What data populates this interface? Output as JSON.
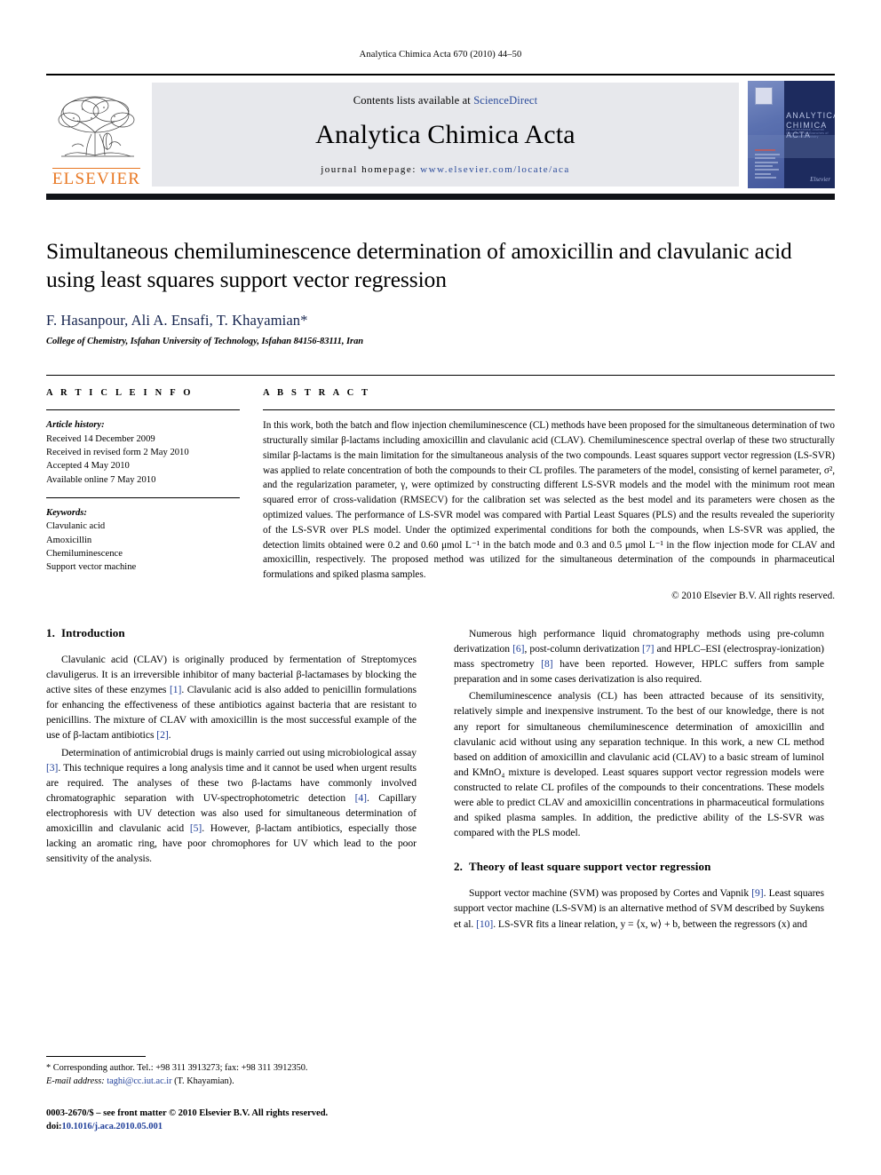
{
  "running_head": "Analytica Chimica Acta 670 (2010) 44–50",
  "masthead": {
    "publisher_name": "ELSEVIER",
    "contents_prefix": "Contents lists available at ",
    "contents_link": "ScienceDirect",
    "journal_title": "Analytica Chimica Acta",
    "homepage_prefix": "journal homepage: ",
    "homepage_url": "www.elsevier.com/locate/aca",
    "cover": {
      "title_line1": "ANALYTICA",
      "title_line2": "CHIMICA ACTA",
      "subtitle": "An International Journal Devoted to All Branches of Analytical Chemistry",
      "brand": "Elsevier"
    }
  },
  "article": {
    "title": "Simultaneous chemiluminescence determination of amoxicillin and clavulanic acid using least squares support vector regression",
    "authors": "F. Hasanpour, Ali A. Ensafi, T. Khayamian",
    "corresponding_marker": "*",
    "affiliation": "College of Chemistry, Isfahan University of Technology, Isfahan 84156-83111, Iran"
  },
  "article_info": {
    "label": "A R T I C L E    I N F O",
    "history_label": "Article history:",
    "history": [
      "Received 14 December 2009",
      "Received in revised form 2 May 2010",
      "Accepted 4 May 2010",
      "Available online 7 May 2010"
    ],
    "keywords_label": "Keywords:",
    "keywords": [
      "Clavulanic acid",
      "Amoxicillin",
      "Chemiluminescence",
      "Support vector machine"
    ]
  },
  "abstract": {
    "label": "A B S T R A C T",
    "text": "In this work, both the batch and flow injection chemiluminescence (CL) methods have been proposed for the simultaneous determination of two structurally similar β-lactams including amoxicillin and clavulanic acid (CLAV). Chemiluminescence spectral overlap of these two structurally similar β-lactams is the main limitation for the simultaneous analysis of the two compounds. Least squares support vector regression (LS-SVR) was applied to relate concentration of both the compounds to their CL profiles. The parameters of the model, consisting of kernel parameter, σ², and the regularization parameter, γ, were optimized by constructing different LS-SVR models and the model with the minimum root mean squared error of cross-validation (RMSECV) for the calibration set was selected as the best model and its parameters were chosen as the optimized values. The performance of LS-SVR model was compared with Partial Least Squares (PLS) and the results revealed the superiority of the LS-SVR over PLS model. Under the optimized experimental conditions for both the compounds, when LS-SVR was applied, the detection limits obtained were 0.2 and 0.60 μmol L⁻¹ in the batch mode and 0.3 and 0.5 μmol L⁻¹ in the flow injection mode for CLAV and amoxicillin, respectively. The proposed method was utilized for the simultaneous determination of the compounds in pharmaceutical formulations and spiked plasma samples.",
    "copyright": "© 2010 Elsevier B.V. All rights reserved."
  },
  "sections": {
    "intro": {
      "number": "1.",
      "heading": "Introduction",
      "paragraphs": [
        "Clavulanic acid (CLAV) is originally produced by fermentation of Streptomyces clavuligerus. It is an irreversible inhibitor of many bacterial β-lactamases by blocking the active sites of these enzymes [1]. Clavulanic acid is also added to penicillin formulations for enhancing the effectiveness of these antibiotics against bacteria that are resistant to penicillins. The mixture of CLAV with amoxicillin is the most successful example of the use of β-lactam antibiotics [2].",
        "Determination of antimicrobial drugs is mainly carried out using microbiological assay [3]. This technique requires a long analysis time and it cannot be used when urgent results are required. The analyses of these two β-lactams have commonly involved chromatographic separation with UV-spectrophotometric detection [4]. Capillary electrophoresis with UV detection was also used for simultaneous determination of amoxicillin and clavulanic acid [5]. However, β-lactam antibiotics, especially those lacking an aromatic ring, have poor chromophores for UV which lead to the poor sensitivity of the analysis.",
        "Numerous high performance liquid chromatography methods using pre-column derivatization [6], post-column derivatization [7] and HPLC–ESI (electrospray-ionization) mass spectrometry [8] have been reported. However, HPLC suffers from sample preparation and in some cases derivatization is also required.",
        "Chemiluminescence analysis (CL) has been attracted because of its sensitivity, relatively simple and inexpensive instrument. To the best of our knowledge, there is not any report for simultaneous chemiluminescence determination of amoxicillin and clavulanic acid without using any separation technique. In this work, a new CL method based on addition of amoxicillin and clavulanic acid (CLAV) to a basic stream of luminol and KMnO₄ mixture is developed. Least squares support vector regression models were constructed to relate CL profiles of the compounds to their concentrations. These models were able to predict CLAV and amoxicillin concentrations in pharmaceutical formulations and spiked plasma samples. In addition, the predictive ability of the LS-SVR was compared with the PLS model."
      ]
    },
    "theory": {
      "number": "2.",
      "heading": "Theory of least square support vector regression",
      "paragraph": "Support vector machine (SVM) was proposed by Cortes and Vapnik [9]. Least squares support vector machine (LS-SVM) is an alternative method of SVM described by Suykens et al. [10]. LS-SVR fits a linear relation, y = ⟨x, w⟩ + b, between the regressors (x) and"
    }
  },
  "footnotes": {
    "corresponding": "* Corresponding author. Tel.: +98 311 3913273; fax: +98 311 3912350.",
    "email_label": "E-mail address: ",
    "email": "taghi@cc.iut.ac.ir",
    "email_suffix": " (T. Khayamian).",
    "imprint": "0003-2670/$ – see front matter © 2010 Elsevier B.V. All rights reserved.",
    "doi_label": "doi:",
    "doi": "10.1016/j.aca.2010.05.001"
  },
  "colors": {
    "link_blue": "#21409a",
    "elsevier_orange": "#E87722",
    "band_gray": "#e7e8ec"
  }
}
